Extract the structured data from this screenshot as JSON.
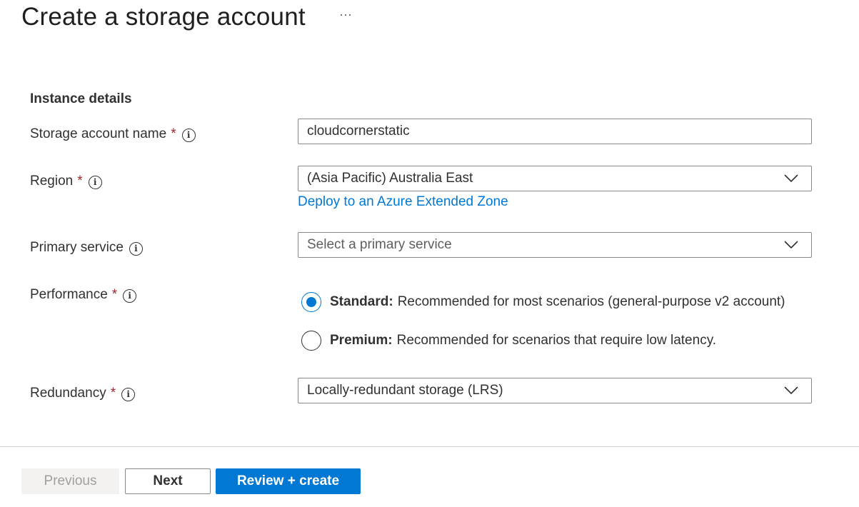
{
  "header": {
    "title": "Create a storage account",
    "more_label": "···"
  },
  "instance_details": {
    "heading": "Instance details",
    "storage_account_name": {
      "label": "Storage account name",
      "required_mark": "*",
      "value": "cloudcornerstatic"
    },
    "region": {
      "label": "Region",
      "required_mark": "*",
      "selected": "(Asia Pacific) Australia East",
      "link": "Deploy to an Azure Extended Zone"
    },
    "primary_service": {
      "label": "Primary service",
      "placeholder": "Select a primary service"
    },
    "performance": {
      "label": "Performance",
      "required_mark": "*",
      "options": [
        {
          "name": "Standard:",
          "description": "Recommended for most scenarios (general-purpose v2 account)",
          "checked": true
        },
        {
          "name": "Premium:",
          "description": "Recommended for scenarios that require low latency.",
          "checked": false
        }
      ]
    },
    "redundancy": {
      "label": "Redundancy",
      "required_mark": "*",
      "selected": "Locally-redundant storage (LRS)"
    }
  },
  "footer": {
    "previous_label": "Previous",
    "next_label": "Next",
    "review_label": "Review + create"
  },
  "colors": {
    "accent": "#0078d4",
    "required": "#a4262c",
    "disabled_bg": "#f3f2f1"
  },
  "icons": {
    "info": "info-icon",
    "more": "more-icon",
    "dropdown": "chevron-down-icon"
  }
}
